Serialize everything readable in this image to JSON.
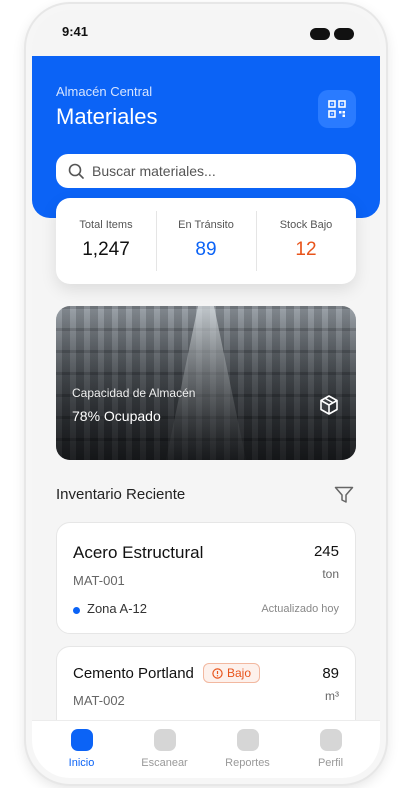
{
  "status_bar": {
    "time": "9:41"
  },
  "header": {
    "subtitle": "Almacén Central",
    "title": "Materiales",
    "qr_icon": "qr-code-icon"
  },
  "search": {
    "placeholder": "Buscar materiales...",
    "value": ""
  },
  "stats": [
    {
      "label": "Total Items",
      "value": "1,247",
      "color": "#111111"
    },
    {
      "label": "En Tránsito",
      "value": "89",
      "color": "#0b63f6"
    },
    {
      "label": "Stock Bajo",
      "value": "12",
      "color": "#e8541b"
    }
  ],
  "capacity": {
    "label": "Capacidad de Almacén",
    "value": "78% Ocupado",
    "icon": "box-icon"
  },
  "inventory": {
    "title": "Inventario Reciente",
    "filter_icon": "filter-icon",
    "items": [
      {
        "name": "Acero Estructural",
        "code": "MAT-001",
        "quantity": "245",
        "unit": "ton",
        "zone": "Zona A-12",
        "updated": "Actualizado hoy"
      },
      {
        "name": "Cemento Portland",
        "code": "MAT-002",
        "quantity": "89",
        "unit": "m³",
        "badge": "Bajo"
      }
    ]
  },
  "nav": [
    {
      "label": "Inicio",
      "active": true
    },
    {
      "label": "Escanear",
      "active": false
    },
    {
      "label": "Reportes",
      "active": false
    },
    {
      "label": "Perfil",
      "active": false
    }
  ],
  "colors": {
    "primary": "#0b63f6",
    "warning": "#e8541b",
    "background": "#f5f5f5"
  }
}
